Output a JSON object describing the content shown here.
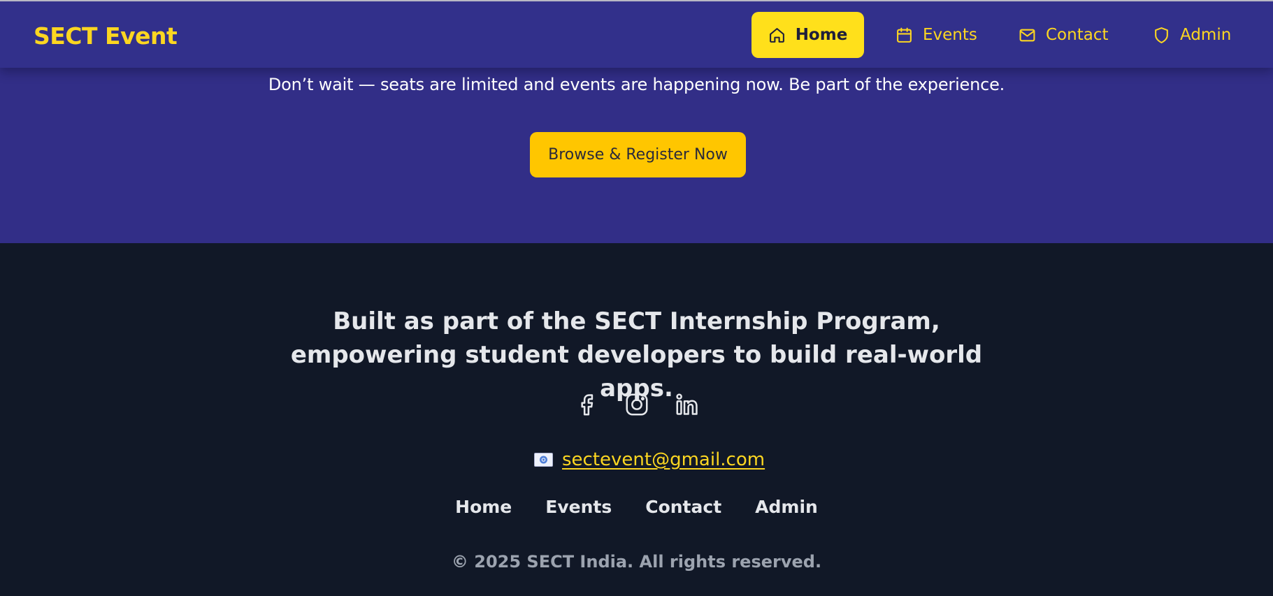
{
  "brand": "SECT Event",
  "nav": {
    "items": [
      {
        "label": "Home",
        "icon": "home-icon",
        "active": true
      },
      {
        "label": "Events",
        "icon": "calendar-icon",
        "active": false
      },
      {
        "label": "Contact",
        "icon": "mail-icon",
        "active": false
      },
      {
        "label": "Admin",
        "icon": "shield-icon",
        "active": false
      }
    ]
  },
  "hero": {
    "text": "Don’t wait — seats are limited and events are happening now. Be part of the experience.",
    "cta_label": "Browse & Register Now"
  },
  "footer": {
    "tagline": "Built as part of the SECT Internship Program, empowering student developers to build real-world apps.",
    "socials": [
      "facebook-icon",
      "instagram-icon",
      "linkedin-icon"
    ],
    "email": "sectevent@gmail.com",
    "email_icon": "email-emoji-icon",
    "links": [
      "Home",
      "Events",
      "Contact",
      "Admin"
    ],
    "copyright": "© 2025 SECT India. All rights reserved."
  },
  "colors": {
    "navbar": "#32308b",
    "hero_bg": "#322e87",
    "accent_yellow": "#fcd621",
    "active_button": "#ffe01b",
    "cta_button": "#ffc600",
    "footer_bg": "#111827",
    "footer_text": "#e5e7eb",
    "muted_text": "#9ca3af"
  }
}
